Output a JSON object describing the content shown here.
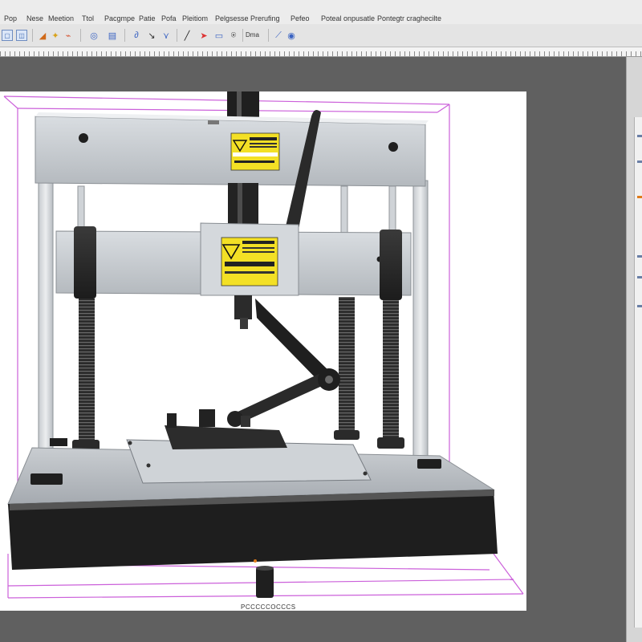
{
  "app": {
    "menu": [
      {
        "label": "Pop"
      },
      {
        "label": "Nese"
      },
      {
        "label": "Meetion"
      },
      {
        "label": "Ttol"
      },
      {
        "label": "Pacgmpe"
      },
      {
        "label": "Patie"
      },
      {
        "label": "Pofa"
      },
      {
        "label": "Pleitiom"
      },
      {
        "label": "Pelgsesse Prerufing"
      },
      {
        "label": "Pefeo"
      },
      {
        "label": "Poteal onpusatle"
      },
      {
        "label": "Pontegtr craghecilte"
      }
    ]
  },
  "toolbar": {
    "tools": [
      {
        "icon": "select-icon"
      },
      {
        "icon": "zoom-icon"
      },
      {
        "icon": "paint-icon"
      },
      {
        "icon": "fill-icon"
      },
      {
        "icon": "info-icon"
      },
      {
        "icon": "document-icon"
      },
      {
        "icon": "pen-icon"
      },
      {
        "icon": "vector-icon"
      },
      {
        "icon": "stroke-icon"
      },
      {
        "icon": "pencil-icon"
      },
      {
        "icon": "marker-icon"
      },
      {
        "icon": "save-icon"
      },
      {
        "icon": "lock-icon"
      },
      {
        "icon": "crop-icon"
      },
      {
        "icon": "node-icon"
      },
      {
        "icon": "help-icon"
      }
    ],
    "crop_label": "Dma"
  },
  "canvas": {
    "caption": "PCCCCCOCCCS",
    "warning_label_top": {
      "title": "WARNING",
      "text": "WARNING TERRODS"
    },
    "warning_label_mid": {
      "title": "WARNING",
      "text": "WARNING"
    }
  },
  "colors": {
    "menubar_bg": "#ececec",
    "toolbar_bg": "#e4e4e4",
    "canvas_bg": "#606060",
    "artboard_bg": "#ffffff",
    "selection_guides": "#c64fd6",
    "warning_yellow": "#f3e025"
  }
}
